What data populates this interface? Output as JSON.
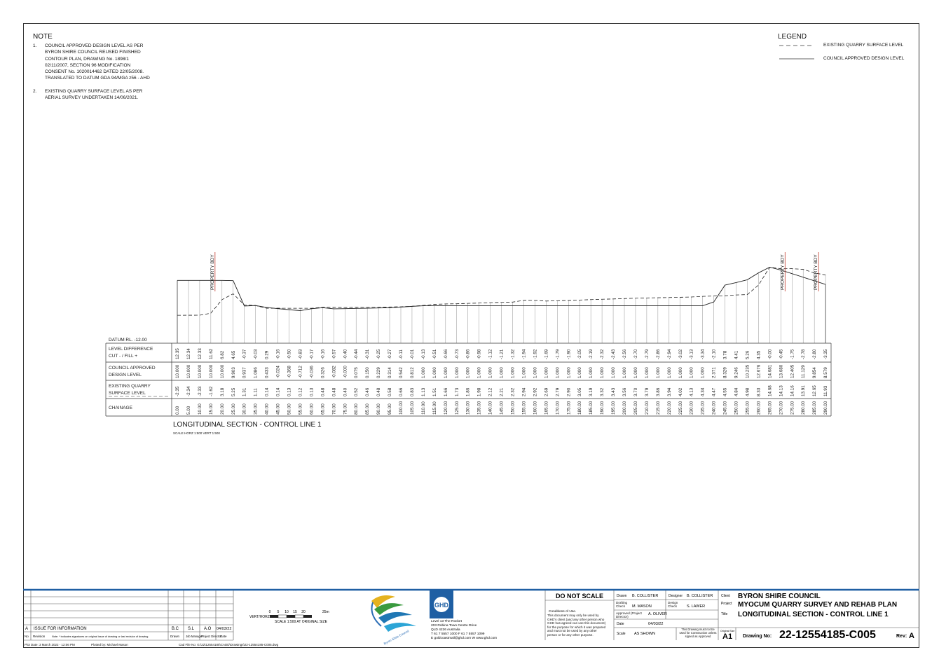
{
  "notes": {
    "title": "NOTE",
    "items": [
      {
        "num": "1.",
        "text": "COUNCIL APPROVED DESIGN LEVEL AS PER\nBYRON SHIRE COUNCIL REUSED FINISHED\nCONTOUR PLAN, DRAWING No. 1898/1\n02/11/2007, SECTION 96 MODIFICATION\nCONSENT No. 1020014462 DATED 22/05/2008.\nTRANSLATED TO DATUM GDA 94/MGA z56 - AHD"
      },
      {
        "num": "2.",
        "text": "EXISTING QUARRY SURFACE LEVEL AS PER\nAERIAL SURVEY UNDERTAKEN 14/06/2021."
      }
    ]
  },
  "legend": {
    "title": "LEGEND",
    "existing": "EXISTING QUARRY SURFACE LEVEL",
    "design": "COUNCIL APPROVED DESIGN LEVEL"
  },
  "section": {
    "datum": "DATUM RL. -12.00",
    "title": "LONGITUDINAL SECTION - CONTROL LINE 1",
    "scale": "SCALE  HORZ 1:500   VERT 1:500",
    "property_labels": [
      "PROPERTY BDY",
      "PROPERTY BDY",
      "PROPERTY BDY"
    ],
    "row_labels": {
      "level_difference": [
        "LEVEL DIFFERENCE",
        "CUT - / FILL +"
      ],
      "design": [
        "COUNCIL APPROVED",
        "DESIGN LEVEL"
      ],
      "existing": [
        "EXISTING QUARRY",
        "SURFACE LEVEL"
      ],
      "chainage": [
        "CHAINAGE"
      ]
    },
    "chainage": [
      "0.00",
      "5.00",
      "10.00",
      "15.00",
      "20.00",
      "25.00",
      "30.00",
      "35.00",
      "40.00",
      "45.00",
      "50.00",
      "55.00",
      "60.00",
      "65.00",
      "70.00",
      "75.00",
      "80.00",
      "85.00",
      "90.00",
      "95.00",
      "100.00",
      "105.00",
      "110.00",
      "115.00",
      "120.00",
      "125.00",
      "130.00",
      "135.00",
      "140.00",
      "145.00",
      "150.00",
      "155.00",
      "160.00",
      "165.00",
      "170.00",
      "175.00",
      "180.00",
      "185.00",
      "190.00",
      "195.00",
      "200.00",
      "205.00",
      "210.00",
      "215.00",
      "220.00",
      "225.00",
      "230.00",
      "235.00",
      "240.00",
      "245.00",
      "250.00",
      "255.00",
      "260.00",
      "265.00",
      "270.00",
      "275.00",
      "280.00",
      "285.00",
      "290.00"
    ],
    "existing": [
      "-2.35",
      "-2.34",
      "-2.33",
      "-1.62",
      "3.18",
      "5.25",
      "1.31",
      "1.11",
      "0.14",
      "0.14",
      "0.13",
      "0.12",
      "0.13",
      "0.48",
      "0.48",
      "0.40",
      "0.52",
      "0.46",
      "0.48",
      "0.58",
      "0.66",
      "0.83",
      "1.13",
      "1.51",
      "1.66",
      "1.73",
      "1.86",
      "1.98",
      "2.12",
      "2.21",
      "2.32",
      "2.94",
      "2.92",
      "2.69",
      "2.79",
      "2.90",
      "3.05",
      "3.19",
      "3.32",
      "3.43",
      "3.56",
      "3.70",
      "3.79",
      "3.86",
      "3.94",
      "4.02",
      "4.13",
      "4.34",
      "4.47",
      "4.55",
      "4.84",
      "4.98",
      "8.33",
      "14.68",
      "14.13",
      "14.16",
      "13.91",
      "12.65",
      "11.93"
    ],
    "design": [
      "10.000",
      "10.000",
      "10.000",
      "10.000",
      "10.000",
      "9.903",
      "0.937",
      "1.086",
      "0.433",
      "-0.024",
      "-0.368",
      "-0.712",
      "-0.036",
      "0.326",
      "-0.082",
      "-0.000",
      "0.075",
      "0.150",
      "0.229",
      "0.314",
      "0.542",
      "0.812",
      "1.000",
      "1.000",
      "1.000",
      "1.000",
      "1.000",
      "1.000",
      "1.000",
      "1.000",
      "1.000",
      "1.000",
      "1.000",
      "1.000",
      "1.000",
      "1.000",
      "1.000",
      "1.000",
      "1.000",
      "1.000",
      "1.000",
      "1.000",
      "1.000",
      "1.000",
      "1.000",
      "1.000",
      "1.000",
      "1.000",
      "2.371",
      "8.329",
      "9.246",
      "10.235",
      "12.676",
      "14.681",
      "13.680",
      "12.405",
      "11.129",
      "9.854",
      "8.579"
    ],
    "difference": [
      "12.35",
      "12.34",
      "12.33",
      "11.62",
      "6.82",
      "4.65",
      "-0.37",
      "-0.03",
      "0.29",
      "-0.16",
      "-0.50",
      "-0.83",
      "-0.17",
      "-0.16",
      "-0.57",
      "-0.40",
      "-0.44",
      "-0.31",
      "-0.25",
      "-0.27",
      "-0.11",
      "-0.01",
      "-0.13",
      "-0.51",
      "-0.66",
      "-0.73",
      "-0.86",
      "-0.98",
      "-1.12",
      "-1.21",
      "-1.32",
      "-1.94",
      "-1.92",
      "-1.69",
      "-1.79",
      "-1.90",
      "-2.05",
      "-2.19",
      "-2.32",
      "-2.43",
      "-2.56",
      "-2.70",
      "-2.79",
      "-2.86",
      "-2.94",
      "-3.02",
      "-3.13",
      "-3.34",
      "-2.10",
      "3.78",
      "4.41",
      "5.26",
      "4.35",
      "-0.00",
      "-0.45",
      "-1.75",
      "-2.78",
      "-2.80",
      "-3.35"
    ]
  },
  "revisions": {
    "row": {
      "rev": "A",
      "desc": "ISSUE FOR INFORMATION",
      "drawn": "B.C",
      "job_manager": "S.L",
      "director": "A.O",
      "date": "04/03/22"
    },
    "headers": {
      "no": "No",
      "revision": "Revision",
      "note": "Note: * indicates signatures on original issue of drawing or last revision of drawing",
      "drawn": "Drawn",
      "job_manager": "Job Manager",
      "director": "Project Director",
      "date": "Date"
    }
  },
  "scalebar": {
    "label": "VERT/HORZ",
    "ticks": [
      "0",
      "5",
      "10",
      "15",
      "20",
      "25m"
    ],
    "caption": "SCALE 1:500  AT ORIGINAL SIZE"
  },
  "logos": {
    "council": "Byron Shire Council",
    "ghd": "GHD"
  },
  "ghd_address": {
    "line1": "Level 13 The Rocket",
    "line2": "203 Robina Town Centre Drive",
    "line3": "QLD 4226 Australia",
    "line4": "T 61 7 5557 1000  F 61 7 5557 1099",
    "line5": "E goldcoastmail@ghd.com  W www.ghd.com"
  },
  "conditions": {
    "dns": "DO NOT SCALE",
    "title": "Conditions of Use.",
    "text": "This document may only be used by\nGHD's client (and any other person who\nGHD has agreed can use this document)\nfor the purpose for which it was prepared\nand must not be used by any other\nperson or for any other purpose."
  },
  "signoff": {
    "drawn_label": "Drawn",
    "drawn": "B. COLLISTER",
    "designer_label": "Designer",
    "designer": "B. COLLISTER",
    "drafting_label": "Drafting Check",
    "drafting": "M. MASON",
    "design_check_label": "Design Check",
    "design_check": "S. LAWER",
    "approved_label": "Approved (Project Director)",
    "approved": "A. OLIVER",
    "date_label": "Date",
    "date": "04/03/22",
    "scale_label": "Scale",
    "scale": "AS SHOWN",
    "construction_note": "This Drawing must not be\nused for Construction unless\nsigned as Approved"
  },
  "titleblock": {
    "client_label": "Client",
    "client": "BYRON SHIRE COUNCIL",
    "project_label": "Project",
    "project": "MYOCUM QUARRY SURVEY AND REHAB PLAN",
    "title_label": "Title",
    "title": "LONGITUDINAL SECTION - CONTROL LINE 1",
    "size_label": "Original Size",
    "size": "A1",
    "drawing_no_label": "Drawing No:",
    "drawing_no": "22-12554185-C005",
    "rev_label": "Rev:",
    "rev": "A"
  },
  "footer": {
    "plot_date": "Plot Date:   3 March 2022 - 12:06 PM",
    "plotted_by": "Plotted by:   Michael Mason",
    "cad_file": "Cad File No:   G:\\22\\12554185\\CADD\\Drawings\\22-12554185-C005.dwg"
  },
  "colors": {
    "accent_blue": "#1f5fa3",
    "property_line": "#c0392b",
    "line": "#333333"
  }
}
